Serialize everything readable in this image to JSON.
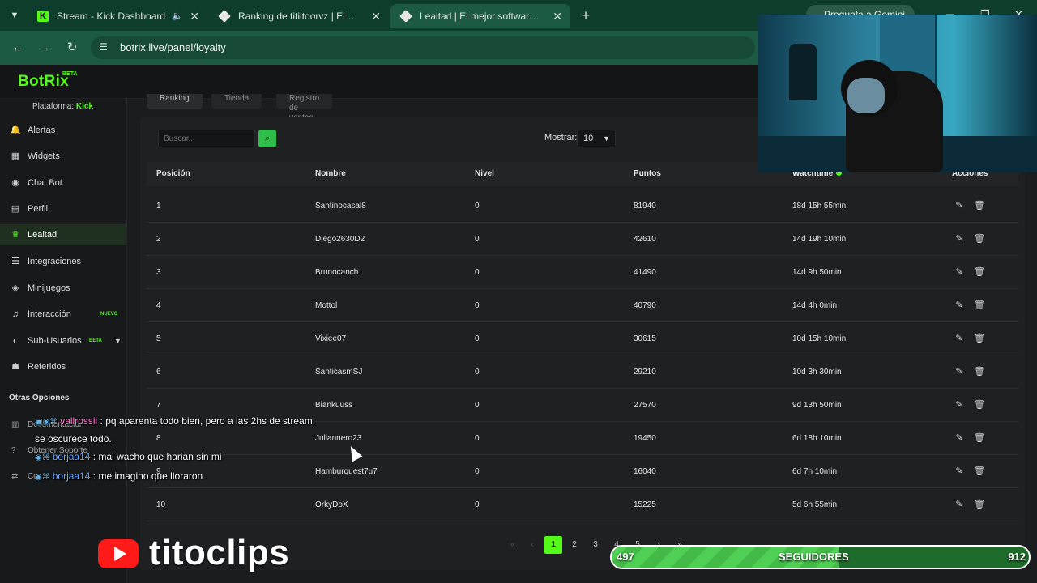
{
  "browser": {
    "tabs": [
      {
        "title": "Stream - Kick Dashboard",
        "icon": "kick-icon",
        "active": false
      },
      {
        "title": "Ranking de titiitoorvz | El mejor",
        "icon": "botrix-icon",
        "active": false
      },
      {
        "title": "Lealtad | El mejor software para",
        "icon": "botrix-icon",
        "active": true
      }
    ],
    "gemini": "Pregunta a Gemini",
    "url": "botrix.live/panel/loyalty"
  },
  "app": {
    "logo": "BotRix",
    "logo_badge": "BETA"
  },
  "sidebar": {
    "platform_label": "Plataforma:",
    "platform_value": "Kick",
    "items": [
      {
        "label": "Alertas",
        "icon": "bell-icon"
      },
      {
        "label": "Widgets",
        "icon": "grid-icon"
      },
      {
        "label": "Chat Bot",
        "icon": "robot-icon"
      },
      {
        "label": "Perfil",
        "icon": "id-card-icon"
      },
      {
        "label": "Lealtad",
        "icon": "trophy-icon",
        "active": true
      },
      {
        "label": "Integraciones",
        "icon": "list-icon"
      },
      {
        "label": "Minijuegos",
        "icon": "gamepad-icon"
      },
      {
        "label": "Interacción",
        "icon": "music-icon",
        "badge": "NUEVO"
      },
      {
        "label": "Sub-Usuarios",
        "icon": "users-icon",
        "badge": "BETA"
      },
      {
        "label": "Referidos",
        "icon": "user-group-icon"
      }
    ],
    "section_title": "Otras Opciones",
    "sub_items": [
      "Documentación",
      "Obtener Soporte",
      "Co..."
    ]
  },
  "main": {
    "tabs": [
      "Ranking",
      "Tienda",
      "Registro de ventas"
    ],
    "search_placeholder": "Buscar...",
    "show_label": "Mostrar:",
    "show_value": "10",
    "columns": [
      "Posición",
      "Nombre",
      "Nivel",
      "Puntos",
      "Watchtime",
      "Acciones"
    ],
    "rows": [
      {
        "pos": "1",
        "name": "Santinocasal8",
        "level": "0",
        "points": "81940",
        "watchtime": "18d 15h 55min"
      },
      {
        "pos": "2",
        "name": "Diego2630D2",
        "level": "0",
        "points": "42610",
        "watchtime": "14d 19h 10min"
      },
      {
        "pos": "3",
        "name": "Brunocanch",
        "level": "0",
        "points": "41490",
        "watchtime": "14d 9h 50min"
      },
      {
        "pos": "4",
        "name": "Mottol",
        "level": "0",
        "points": "40790",
        "watchtime": "14d 4h 0min"
      },
      {
        "pos": "5",
        "name": "Vixiee07",
        "level": "0",
        "points": "30615",
        "watchtime": "10d 15h 10min"
      },
      {
        "pos": "6",
        "name": "SanticasmSJ",
        "level": "0",
        "points": "29210",
        "watchtime": "10d 3h 30min"
      },
      {
        "pos": "7",
        "name": "Biankuuss",
        "level": "0",
        "points": "27570",
        "watchtime": "9d 13h 50min"
      },
      {
        "pos": "8",
        "name": "Juliannero23",
        "level": "0",
        "points": "19450",
        "watchtime": "6d 18h 10min"
      },
      {
        "pos": "9",
        "name": "Hamburquest7u7",
        "level": "0",
        "points": "16040",
        "watchtime": "6d 7h 10min"
      },
      {
        "pos": "10",
        "name": "OrkyDoX",
        "level": "0",
        "points": "15225",
        "watchtime": "5d 6h 55min"
      }
    ],
    "pages": [
      "1",
      "2",
      "3",
      "4",
      "5"
    ],
    "current_page": "1"
  },
  "chat": [
    {
      "user": "vallrossii",
      "message": "pq aparenta todo bien, pero a las 2hs de stream, se oscurece todo..",
      "color": "#ff7ad0"
    },
    {
      "user": "borjaa14",
      "message": "mal wacho que harian sin mi",
      "color": "#6aa7ff"
    },
    {
      "user": "borjaa14",
      "message": "me imagino que lloraron",
      "color": "#6aa7ff"
    }
  ],
  "overlay": {
    "brand": "titoclips",
    "followers_current": "497",
    "followers_label": "SEGUIDORES",
    "followers_goal": "912",
    "followers_progress": 0.545
  },
  "colors": {
    "accent": "#53fc18",
    "browser": "#1d5a43",
    "bg": "#1b1c1e"
  }
}
